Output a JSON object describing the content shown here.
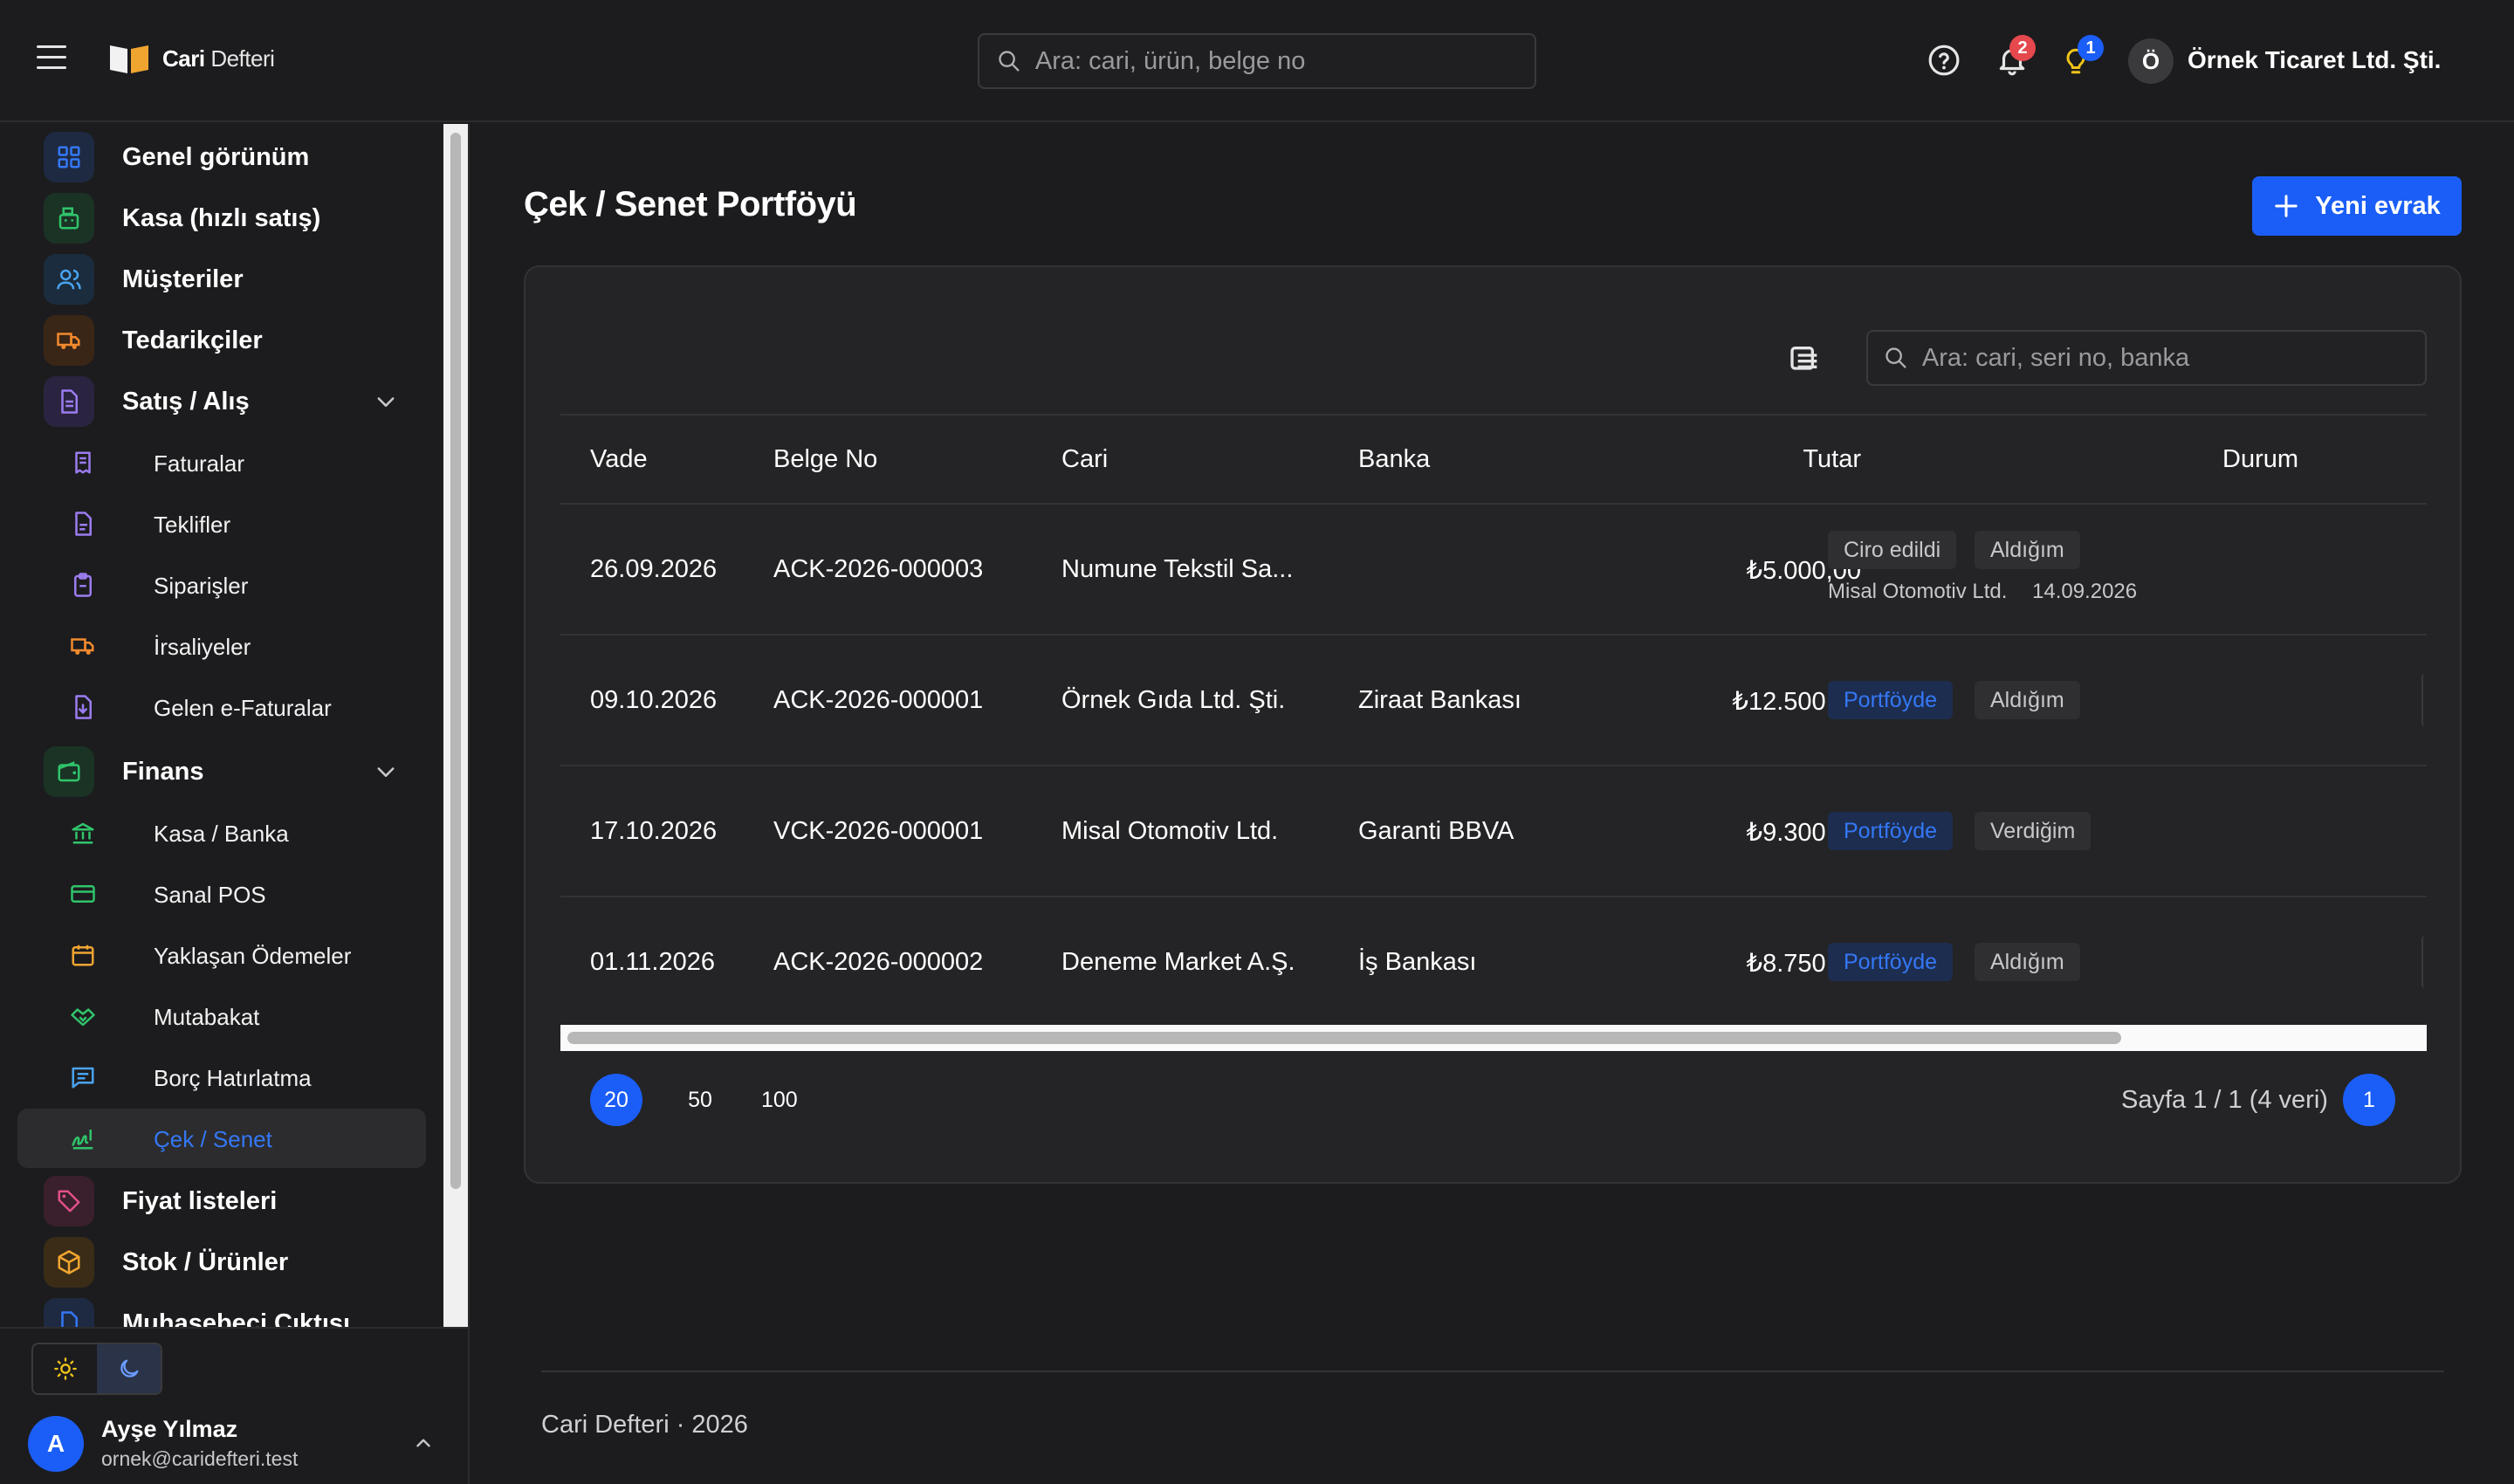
{
  "app": {
    "brand_bold": "Cari",
    "brand_rest": "Defteri"
  },
  "header": {
    "search_placeholder": "Ara: cari, ürün, belge no",
    "notifications_count": "2",
    "tips_count": "1",
    "company_initial": "Ö",
    "company_name": "Örnek Ticaret Ltd. Şti."
  },
  "sidebar": {
    "items": [
      {
        "label": "Genel görünüm",
        "icon": "grid-icon",
        "color": "#3478f6"
      },
      {
        "label": "Kasa (hızlı satış)",
        "icon": "cash-register-icon",
        "color": "#30c46b"
      },
      {
        "label": "Müşteriler",
        "icon": "users-icon",
        "color": "#4aa3f0"
      },
      {
        "label": "Tedarikçiler",
        "icon": "truck-icon",
        "color": "#f28a2e"
      },
      {
        "label": "Satış / Alış",
        "icon": "document-icon",
        "color": "#9b7cf0"
      },
      {
        "label": "Finans",
        "icon": "wallet-icon",
        "color": "#30c46b"
      },
      {
        "label": "Fiyat listeleri",
        "icon": "tag-icon",
        "color": "#e0508a"
      },
      {
        "label": "Stok / Ürünler",
        "icon": "box-icon",
        "color": "#f0a531"
      },
      {
        "label": "Muhasebeci Çıktısı",
        "icon": "export-icon",
        "color": "#3478f6"
      }
    ],
    "sales_sub": [
      {
        "label": "Faturalar",
        "icon": "receipt-icon"
      },
      {
        "label": "Teklifler",
        "icon": "file-icon"
      },
      {
        "label": "Siparişler",
        "icon": "clipboard-icon"
      },
      {
        "label": "İrsaliyeler",
        "icon": "truck-icon"
      },
      {
        "label": "Gelen e-Faturalar",
        "icon": "file-download-icon"
      }
    ],
    "finance_sub": [
      {
        "label": "Kasa / Banka",
        "icon": "bank-icon"
      },
      {
        "label": "Sanal POS",
        "icon": "credit-card-icon"
      },
      {
        "label": "Yaklaşan Ödemeler",
        "icon": "calendar-icon"
      },
      {
        "label": "Mutabakat",
        "icon": "handshake-icon"
      },
      {
        "label": "Borç Hatırlatma",
        "icon": "message-icon"
      },
      {
        "label": "Çek / Senet",
        "icon": "signature-icon"
      }
    ],
    "user": {
      "initial": "A",
      "name": "Ayşe Yılmaz",
      "email": "ornek@caridefteri.test"
    }
  },
  "main": {
    "title": "Çek / Senet Portföyü",
    "new_button": "Yeni evrak",
    "table_search_placeholder": "Ara: cari, seri no, banka",
    "columns": [
      "Vade",
      "Belge No",
      "Cari",
      "Banka",
      "Tutar",
      "Durum"
    ],
    "rows": [
      {
        "vade": "26.09.2026",
        "belge_no": "ACK-2026-000003",
        "cari": "Numune Tekstil Sa...",
        "banka": "",
        "tutar": "₺5.000,00",
        "status": "Ciro edildi",
        "direction": "Aldığım",
        "note_party": "Misal Otomotiv Ltd.",
        "note_date": "14.09.2026"
      },
      {
        "vade": "09.10.2026",
        "belge_no": "ACK-2026-000001",
        "cari": "Örnek Gıda Ltd. Şti.",
        "banka": "Ziraat Bankası",
        "tutar": "₺12.500,00",
        "status": "Portföyde",
        "direction": "Aldığım"
      },
      {
        "vade": "17.10.2026",
        "belge_no": "VCK-2026-000001",
        "cari": "Misal Otomotiv Ltd.",
        "banka": "Garanti BBVA",
        "tutar": "₺9.300,00",
        "status": "Portföyde",
        "direction": "Verdiğim"
      },
      {
        "vade": "01.11.2026",
        "belge_no": "ACK-2026-000002",
        "cari": "Deneme Market A.Ş.",
        "banka": "İş Bankası",
        "tutar": "₺8.750,00",
        "status": "Portföyde",
        "direction": "Aldığım"
      }
    ],
    "page_sizes": [
      "20",
      "50",
      "100"
    ],
    "pager_info": "Sayfa 1 / 1 (4 veri)",
    "current_page": "1"
  },
  "footer": {
    "text": "Cari Defteri · 2026"
  },
  "colors": {
    "accent": "#1b5ef7",
    "active_link": "#3478f6",
    "badge_red": "#e5484d"
  }
}
